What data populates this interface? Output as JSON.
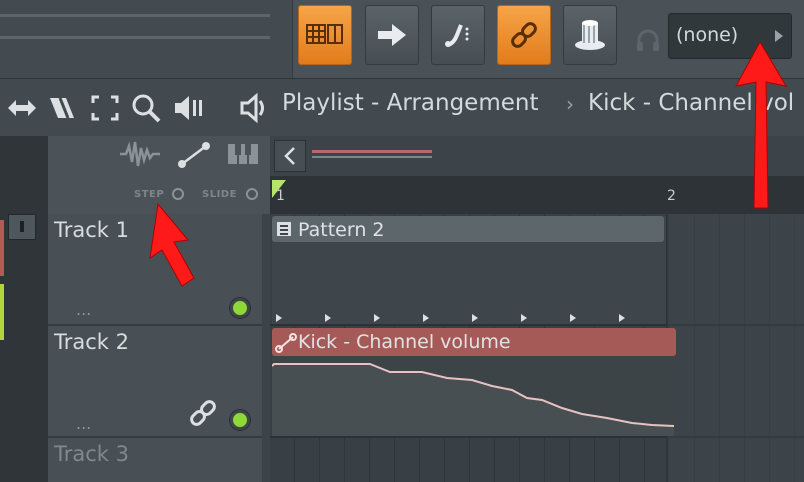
{
  "toolbar": {
    "buttons": [
      {
        "name": "piano-roll-icon",
        "active": true
      },
      {
        "name": "arrow-right-icon",
        "active": false
      },
      {
        "name": "note-icon",
        "active": false
      },
      {
        "name": "link-icon",
        "active": true
      },
      {
        "name": "knob-icon",
        "active": false
      }
    ],
    "output_dropdown": "(none)"
  },
  "navbar": {
    "title": "Playlist - Arrangement",
    "separator": "›",
    "current": "Kick - Channel vol"
  },
  "track_header": {
    "step_label": "STEP",
    "slide_label": "SLIDE"
  },
  "ruler": {
    "bar_1": "1",
    "bar_2": "2"
  },
  "tracks": [
    {
      "name": "Track 1",
      "dots": "..."
    },
    {
      "name": "Track 2",
      "dots": "..."
    },
    {
      "name": "Track 3"
    }
  ],
  "clips": {
    "pattern": "Pattern 2",
    "automation": "Kick - Channel volume"
  },
  "colors": {
    "accent": "#f0932f",
    "led": "#8fd83a",
    "automation_clip": "#a55a57",
    "arrow": "#ff1a1a"
  }
}
